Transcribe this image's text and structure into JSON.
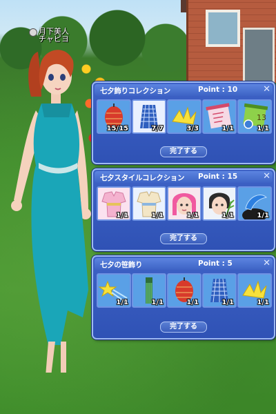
{
  "character": {
    "name_line1": "月下美人",
    "name_line2": "チャピヨ"
  },
  "panels": [
    {
      "title": "七夕飾りコレクション",
      "point_label": "Point",
      "point_sep": ":",
      "point_value": "10",
      "close_icon": "close-icon",
      "complete_label": "完了する",
      "items": [
        {
          "icon": "red-lantern-icon",
          "count": "15/15"
        },
        {
          "icon": "blue-net-ornament-icon",
          "count": "7/7"
        },
        {
          "icon": "paper-crane-icon",
          "count": "3/3"
        },
        {
          "icon": "pink-scroll-icon",
          "count": "1/1"
        },
        {
          "icon": "green-scroll-13-icon",
          "count": "1/1"
        }
      ]
    },
    {
      "title": "七夕スタイルコレクション",
      "point_label": "Point",
      "point_sep": ":",
      "point_value": "15",
      "close_icon": "close-icon",
      "complete_label": "完了する",
      "items": [
        {
          "icon": "pink-yukata-icon",
          "count": "1/1"
        },
        {
          "icon": "cream-yukata-icon",
          "count": "1/1"
        },
        {
          "icon": "pink-hair-face-icon",
          "count": "1/1"
        },
        {
          "icon": "bamboo-face-icon",
          "count": "1/1"
        },
        {
          "icon": "blue-hair-accessory-icon",
          "count": "1/1"
        }
      ]
    },
    {
      "title": "七夕の笹飾り",
      "point_label": "Point",
      "point_sep": ":",
      "point_value": "5",
      "close_icon": "close-icon",
      "complete_label": "完了する",
      "items": [
        {
          "icon": "star-streamer-icon",
          "count": "1/1"
        },
        {
          "icon": "green-streamer-icon",
          "count": "1/1"
        },
        {
          "icon": "red-lantern-icon",
          "count": "1/1"
        },
        {
          "icon": "blue-net-ornament-icon",
          "count": "1/1"
        },
        {
          "icon": "paper-crane-icon",
          "count": "1/1"
        }
      ]
    }
  ],
  "colors": {
    "panel_bg": "#2f52b5",
    "panel_border": "#9db9f3",
    "slot_bg": "#d9e4fb"
  }
}
